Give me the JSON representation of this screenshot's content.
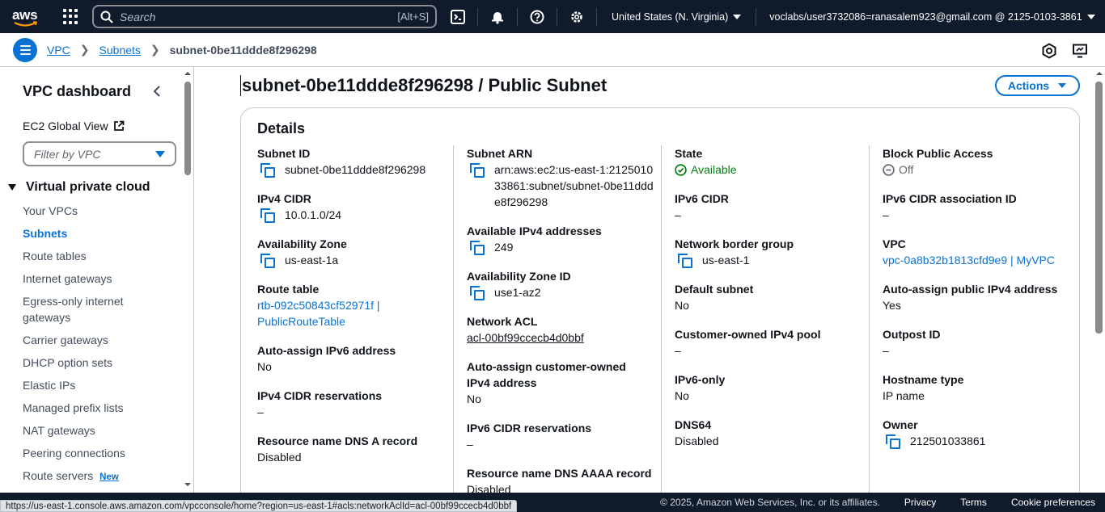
{
  "topnav": {
    "logo_text": "aws",
    "search_placeholder": "Search",
    "search_shortcut": "[Alt+S]",
    "region": "United States (N. Virginia)",
    "account": "voclabs/user3732086=ranasalem923@gmail.com @ 2125-0103-3861"
  },
  "breadcrumb": {
    "items": [
      "VPC",
      "Subnets"
    ],
    "current": "subnet-0be11ddde8f296298"
  },
  "sidebar": {
    "title": "VPC dashboard",
    "ec2_global_view": "EC2 Global View",
    "filter_placeholder": "Filter by VPC",
    "section": "Virtual private cloud",
    "items": [
      "Your VPCs",
      "Subnets",
      "Route tables",
      "Internet gateways",
      "Egress-only internet gateways",
      "Carrier gateways",
      "DHCP option sets",
      "Elastic IPs",
      "Managed prefix lists",
      "NAT gateways",
      "Peering connections",
      "Route servers"
    ],
    "active_item": "Subnets",
    "new_badge": "New"
  },
  "page": {
    "title": "subnet-0be11ddde8f296298 / Public Subnet",
    "actions_label": "Actions"
  },
  "details": {
    "title": "Details",
    "col1": {
      "subnet_id_label": "Subnet ID",
      "subnet_id": "subnet-0be11ddde8f296298",
      "ipv4_cidr_label": "IPv4 CIDR",
      "ipv4_cidr": "10.0.1.0/24",
      "az_label": "Availability Zone",
      "az": "us-east-1a",
      "route_table_label": "Route table",
      "route_table": "rtb-092c50843cf52971f | PublicRouteTable",
      "auto_ipv6_label": "Auto-assign IPv6 address",
      "auto_ipv6": "No",
      "ipv4_res_label": "IPv4 CIDR reservations",
      "ipv4_res": "–",
      "dns_a_label": "Resource name DNS A record",
      "dns_a": "Disabled"
    },
    "col2": {
      "arn_label": "Subnet ARN",
      "arn": "arn:aws:ec2:us-east-1:212501033861:subnet/subnet-0be11ddde8f296298",
      "avail_ipv4_label": "Available IPv4 addresses",
      "avail_ipv4": "249",
      "az_id_label": "Availability Zone ID",
      "az_id": "use1-az2",
      "nacl_label": "Network ACL",
      "nacl": "acl-00bf99ccecb4d0bbf",
      "auto_cust_label": "Auto-assign customer-owned IPv4 address",
      "auto_cust": "No",
      "ipv6_res_label": "IPv6 CIDR reservations",
      "ipv6_res": "–",
      "dns_aaaa_label": "Resource name DNS AAAA record",
      "dns_aaaa": "Disabled"
    },
    "col3": {
      "state_label": "State",
      "state": "Available",
      "ipv6_cidr_label": "IPv6 CIDR",
      "ipv6_cidr": "–",
      "nbg_label": "Network border group",
      "nbg": "us-east-1",
      "default_label": "Default subnet",
      "default": "No",
      "coip_label": "Customer-owned IPv4 pool",
      "coip": "–",
      "ipv6_only_label": "IPv6-only",
      "ipv6_only": "No",
      "dns64_label": "DNS64",
      "dns64": "Disabled"
    },
    "col4": {
      "bpa_label": "Block Public Access",
      "bpa": "Off",
      "ipv6_assoc_label": "IPv6 CIDR association ID",
      "ipv6_assoc": "–",
      "vpc_label": "VPC",
      "vpc": "vpc-0a8b32b1813cfd9e9 | MyVPC",
      "auto_pub_label": "Auto-assign public IPv4 address",
      "auto_pub": "Yes",
      "outpost_label": "Outpost ID",
      "outpost": "–",
      "hostname_label": "Hostname type",
      "hostname": "IP name",
      "owner_label": "Owner",
      "owner": "212501033861"
    }
  },
  "footer": {
    "copyright": "© 2025, Amazon Web Services, Inc. or its affiliates.",
    "privacy": "Privacy",
    "terms": "Terms",
    "cookies": "Cookie preferences"
  },
  "status_url": "https://us-east-1.console.aws.amazon.com/vpcconsole/home?region=us-east-1#acls:networkAclId=acl-00bf99ccecb4d0bbf",
  "colors": {
    "link": "#0972d3",
    "nav_bg": "#0f1b2a",
    "success": "#037f0c"
  }
}
